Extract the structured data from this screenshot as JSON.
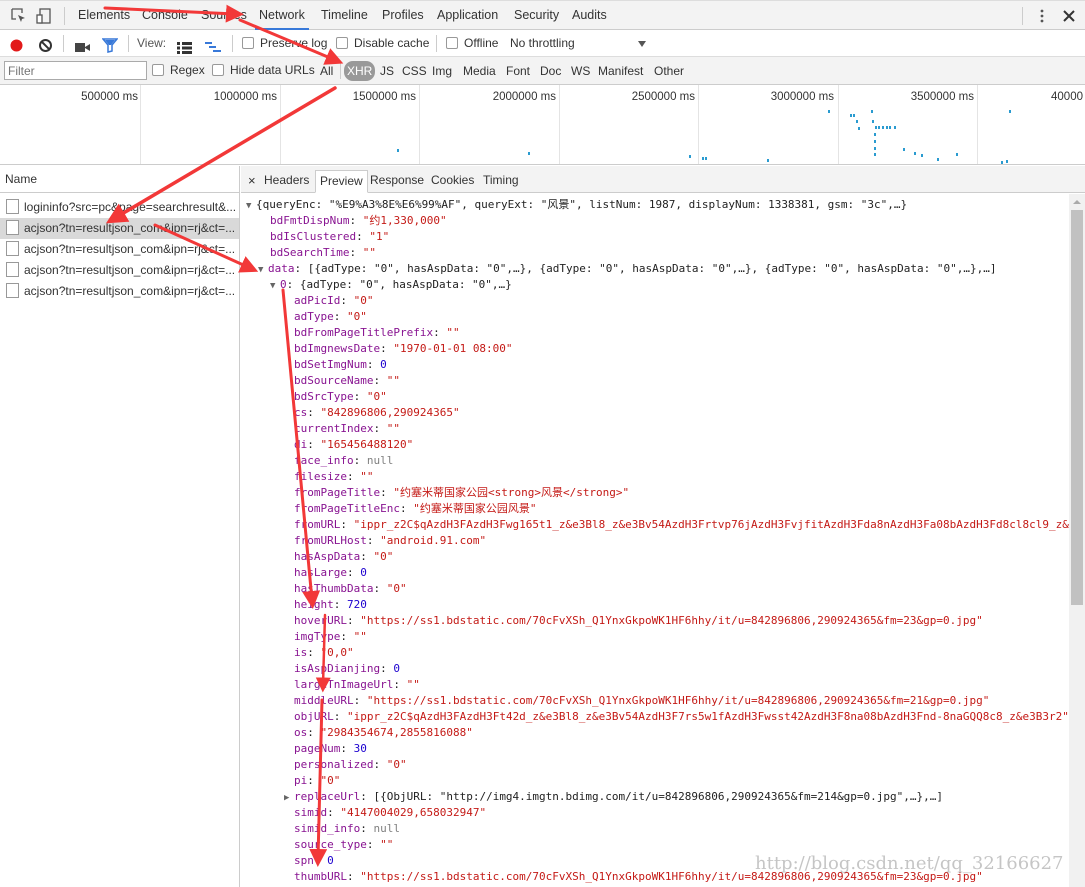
{
  "topbar": {
    "tabs": [
      "Elements",
      "Console",
      "Sources",
      "Network",
      "Timeline",
      "Profiles",
      "Application",
      "Security",
      "Audits"
    ],
    "active_tab": "Network",
    "more_icon": "kebab-menu-icon",
    "close_icon": "close-icon"
  },
  "toolbar": {
    "view_label": "View:",
    "preserve_log": "Preserve log",
    "disable_cache": "Disable cache",
    "offline": "Offline",
    "throttling": "No throttling"
  },
  "filterbar": {
    "filter_placeholder": "Filter",
    "regex": "Regex",
    "hide_data_urls": "Hide data URLs",
    "types": [
      "All",
      "XHR",
      "JS",
      "CSS",
      "Img",
      "Media",
      "Font",
      "Doc",
      "WS",
      "Manifest",
      "Other"
    ],
    "active_type": "XHR"
  },
  "overview": {
    "ticks": [
      "500000 ms",
      "1000000 ms",
      "1500000 ms",
      "2000000 ms",
      "2500000 ms",
      "3000000 ms",
      "3500000 ms",
      "40000"
    ]
  },
  "requests": {
    "header": "Name",
    "rows": [
      "logininfo?src=pc&page=searchresult&...",
      "acjson?tn=resultjson_com&ipn=rj&ct=...",
      "acjson?tn=resultjson_com&ipn=rj&ct=...",
      "acjson?tn=resultjson_com&ipn=rj&ct=...",
      "acjson?tn=resultjson_com&ipn=rj&ct=..."
    ],
    "selected_index": 1
  },
  "detail": {
    "tabs": [
      "Headers",
      "Preview",
      "Response",
      "Cookies",
      "Timing"
    ],
    "active_tab": "Preview"
  },
  "preview": {
    "root_summary": "{queryEnc: \"%E9%A3%8E%E6%99%AF\", queryExt: \"风景\", listNum: 1987, displayNum: 1338381, gsm: \"3c\",…}",
    "root_props": [
      {
        "key": "bdFmtDispNum",
        "value": "\"约1,330,000\"",
        "type": "str"
      },
      {
        "key": "bdIsClustered",
        "value": "\"1\"",
        "type": "str"
      },
      {
        "key": "bdSearchTime",
        "value": "\"\"",
        "type": "str"
      }
    ],
    "data_summary": "[{adType: \"0\", hasAspData: \"0\",…}, {adType: \"0\", hasAspData: \"0\",…}, {adType: \"0\", hasAspData: \"0\",…},…]",
    "item0_summary": "{adType: \"0\", hasAspData: \"0\",…}",
    "item0_props": [
      {
        "key": "adPicId",
        "value": "\"0\"",
        "type": "str"
      },
      {
        "key": "adType",
        "value": "\"0\"",
        "type": "str"
      },
      {
        "key": "bdFromPageTitlePrefix",
        "value": "\"\"",
        "type": "str"
      },
      {
        "key": "bdImgnewsDate",
        "value": "\"1970-01-01 08:00\"",
        "type": "str"
      },
      {
        "key": "bdSetImgNum",
        "value": "0",
        "type": "num"
      },
      {
        "key": "bdSourceName",
        "value": "\"\"",
        "type": "str"
      },
      {
        "key": "bdSrcType",
        "value": "\"0\"",
        "type": "str"
      },
      {
        "key": "cs",
        "value": "\"842896806,290924365\"",
        "type": "str"
      },
      {
        "key": "currentIndex",
        "value": "\"\"",
        "type": "str"
      },
      {
        "key": "di",
        "value": "\"165456488120\"",
        "type": "str"
      },
      {
        "key": "face_info",
        "value": "null",
        "type": "nul"
      },
      {
        "key": "filesize",
        "value": "\"\"",
        "type": "str"
      },
      {
        "key": "fromPageTitle",
        "value": "\"约塞米蒂国家公园<strong>风景</strong>\"",
        "type": "str"
      },
      {
        "key": "fromPageTitleEnc",
        "value": "\"约塞米蒂国家公园风景\"",
        "type": "str"
      },
      {
        "key": "fromURL",
        "value": "\"ippr_z2C$qAzdH3FAzdH3Fwg165t1_z&e3Bl8_z&e3Bv54AzdH3Frtvp76jAzdH3FvjfitAzdH3Fda8nAzdH3Fa08bAzdH3Fd8cl8cl9_z&e",
        "type": "str"
      },
      {
        "key": "fromURLHost",
        "value": "\"android.91.com\"",
        "type": "str"
      },
      {
        "key": "hasAspData",
        "value": "\"0\"",
        "type": "str"
      },
      {
        "key": "hasLarge",
        "value": "0",
        "type": "num"
      },
      {
        "key": "hasThumbData",
        "value": "\"0\"",
        "type": "str"
      },
      {
        "key": "height",
        "value": "720",
        "type": "num"
      },
      {
        "key": "hoverURL",
        "value": "\"https://ss1.bdstatic.com/70cFvXSh_Q1YnxGkpoWK1HF6hhy/it/u=842896806,290924365&fm=23&gp=0.jpg\"",
        "type": "str"
      },
      {
        "key": "imgType",
        "value": "\"\"",
        "type": "str"
      },
      {
        "key": "is",
        "value": "\"0,0\"",
        "type": "str"
      },
      {
        "key": "isAspDianjing",
        "value": "0",
        "type": "num"
      },
      {
        "key": "largeTnImageUrl",
        "value": "\"\"",
        "type": "str"
      },
      {
        "key": "middleURL",
        "value": "\"https://ss1.bdstatic.com/70cFvXSh_Q1YnxGkpoWK1HF6hhy/it/u=842896806,290924365&fm=21&gp=0.jpg\"",
        "type": "str"
      },
      {
        "key": "objURL",
        "value": "\"ippr_z2C$qAzdH3FAzdH3Ft42d_z&e3Bl8_z&e3Bv54AzdH3F7rs5w1fAzdH3Fwsst42AzdH3F8na08bAzdH3Fnd-8naGQQ8c8_z&e3B3r2\"",
        "type": "str"
      },
      {
        "key": "os",
        "value": "\"2984354674,2855816088\"",
        "type": "str"
      },
      {
        "key": "pageNum",
        "value": "30",
        "type": "num"
      },
      {
        "key": "personalized",
        "value": "\"0\"",
        "type": "str"
      },
      {
        "key": "pi",
        "value": "\"0\"",
        "type": "str"
      },
      {
        "key": "replaceUrl",
        "value": "[{ObjURL: \"http://img4.imgtn.bdimg.com/it/u=842896806,290924365&fm=214&gp=0.jpg\",…},…]",
        "type": "plain",
        "expandable": true
      },
      {
        "key": "simid",
        "value": "\"4147004029,658032947\"",
        "type": "str"
      },
      {
        "key": "simid_info",
        "value": "null",
        "type": "nul"
      },
      {
        "key": "source_type",
        "value": "\"\"",
        "type": "str"
      },
      {
        "key": "spn",
        "value": "0",
        "type": "num"
      },
      {
        "key": "thumbURL",
        "value": "\"https://ss1.bdstatic.com/70cFvXSh_Q1YnxGkpoWK1HF6hhy/it/u=842896806,290924365&fm=23&gp=0.jpg\"",
        "type": "str"
      }
    ]
  },
  "watermark": "http://blog.csdn.net/qq_32166627",
  "colors": {
    "accent": "#3879d9",
    "record": "#e21a1a",
    "json_key": "#881391",
    "json_string": "#c41a16",
    "json_number": "#1c00cf",
    "annotation_arrow": "#f23838"
  }
}
